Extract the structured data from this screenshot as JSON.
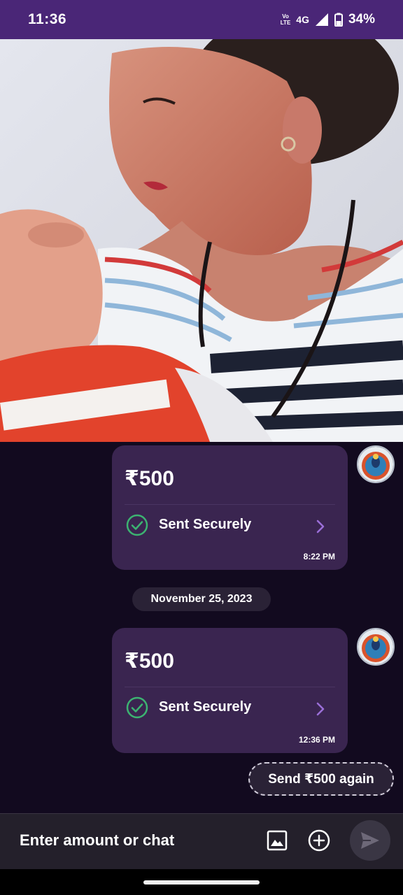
{
  "status_bar": {
    "time": "11:36",
    "volte_top": "Vo",
    "volte_bottom": "LTE",
    "network": "4G",
    "battery": "34%"
  },
  "messages": [
    {
      "amount": "₹500",
      "status": "Sent Securely",
      "time": "8:22 PM"
    },
    {
      "amount": "₹500",
      "status": "Sent Securely",
      "time": "12:36 PM"
    }
  ],
  "date_separator": "November 25, 2023",
  "send_again_label": "Send ₹500 again",
  "input": {
    "placeholder": "Enter amount or chat"
  },
  "colors": {
    "header": "#4a2677",
    "bubble": "#3a2550",
    "success_green": "#3cb371",
    "chevron": "#9b6fd8",
    "background": "#120a1f"
  },
  "icons": [
    "check-circle-icon",
    "chevron-right-icon",
    "image-icon",
    "add-circle-icon",
    "send-icon"
  ]
}
